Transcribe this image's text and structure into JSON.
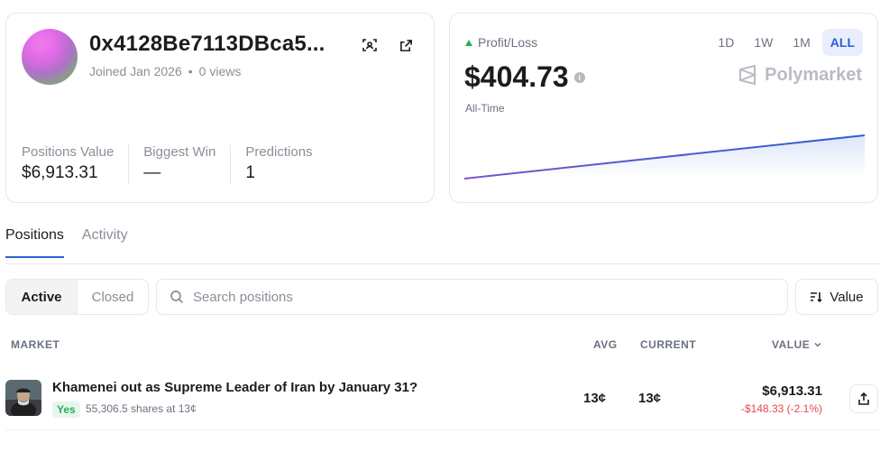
{
  "profile": {
    "address": "0x4128Be7113DBca5...",
    "joined": "Joined Jan 2026",
    "views": "0 views",
    "stats": [
      {
        "label": "Positions Value",
        "value": "$6,913.31"
      },
      {
        "label": "Biggest Win",
        "value": "—"
      },
      {
        "label": "Predictions",
        "value": "1"
      }
    ],
    "icons": [
      "scan-icon",
      "external-link-icon"
    ]
  },
  "pnl": {
    "label": "Profit/Loss",
    "value": "$404.73",
    "range_label": "All-Time",
    "ranges": [
      "1D",
      "1W",
      "1M",
      "ALL"
    ],
    "active_range": "ALL",
    "brand": "Polymarket",
    "colors": {
      "up": "#27ae60",
      "line_start": "#7b55c8",
      "line_end": "#2c5fd8"
    }
  },
  "chart_data": {
    "type": "area",
    "x": [
      0,
      1
    ],
    "y": [
      0,
      404.73
    ],
    "grid": false,
    "legend": "none"
  },
  "tabs": [
    "Positions",
    "Activity"
  ],
  "active_tab": "Positions",
  "filter": {
    "segments": [
      "Active",
      "Closed"
    ],
    "active": "Active",
    "search_placeholder": "Search positions",
    "sort_label": "Value"
  },
  "table": {
    "headers": {
      "market": "MARKET",
      "avg": "AVG",
      "current": "CURRENT",
      "value": "VALUE"
    },
    "rows": [
      {
        "title": "Khamenei out as Supreme Leader of Iran by January 31?",
        "outcome": "Yes",
        "shares": "55,306.5 shares at 13¢",
        "avg": "13¢",
        "current": "13¢",
        "value": "$6,913.31",
        "change": "-$148.33 (-2.1%)"
      }
    ]
  }
}
